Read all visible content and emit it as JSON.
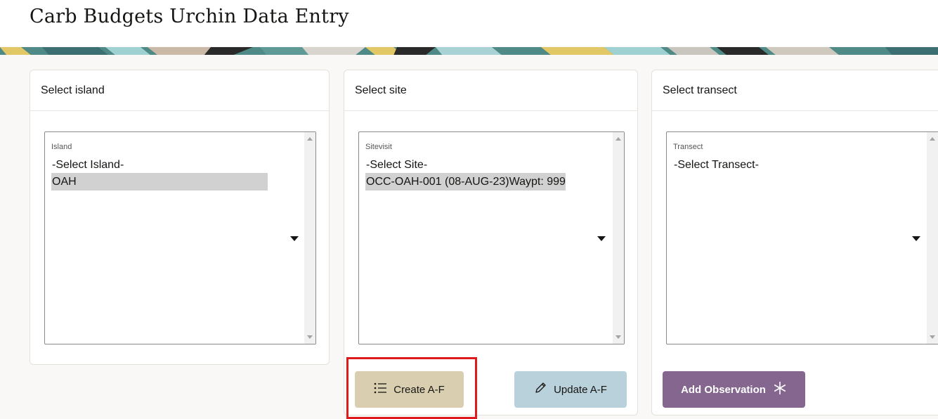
{
  "page": {
    "title": "Carb Budgets Urchin Data Entry"
  },
  "island_card": {
    "title": "Select island",
    "field_label": "Island",
    "options": [
      "-Select Island-",
      "OAH"
    ],
    "selected": "OAH"
  },
  "site_card": {
    "title": "Select site",
    "field_label": "Sitevisit",
    "options": [
      "-Select Site-",
      "OCC-OAH-001 (08-AUG-23)Waypt: 999"
    ],
    "selected": "OCC-OAH-001 (08-AUG-23)Waypt: 999"
  },
  "transect_card": {
    "title": "Select transect",
    "field_label": "Transect",
    "options": [
      "-Select Transect-"
    ]
  },
  "actions": {
    "create_label": "Create A-F",
    "update_label": "Update A-F",
    "add_label": "Add Observation"
  },
  "icons": {
    "create": "list-icon",
    "update": "pencil-icon",
    "add": "asterisk-icon"
  },
  "colors": {
    "create_button": "#d9cfb0",
    "update_button": "#b9d1da",
    "add_button": "#84668f",
    "highlight": "#e0191c"
  }
}
